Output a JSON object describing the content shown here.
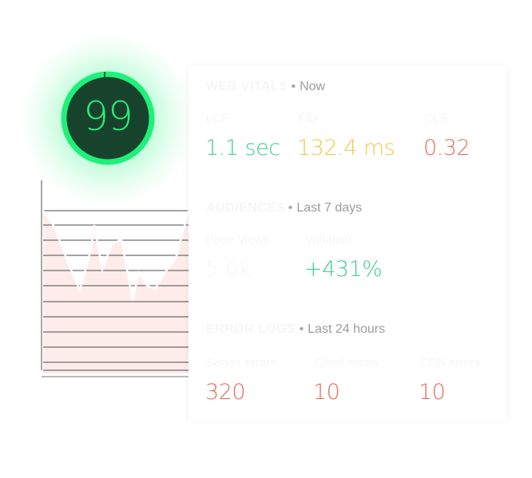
{
  "score": {
    "value": "99",
    "ring_color": "#1ef07a",
    "fill_color": "#17432c",
    "text_color": "#2bea78"
  },
  "mini_chart": {
    "series_color": "#e87a6b",
    "fill_color": "#fdecea"
  },
  "colors": {
    "good": "#3ecf8e",
    "warn": "#f2c94c",
    "bad": "#e0705f"
  },
  "sections": {
    "web_vitals": {
      "name": "WEB VITALS",
      "dot": "•",
      "period": "Now",
      "metrics": [
        {
          "label": "LCP",
          "value": "1.1 sec",
          "status": "good"
        },
        {
          "label": "FID",
          "value": "132.4 ms",
          "status": "warn"
        },
        {
          "label": "CLS",
          "value": "0.32",
          "status": "bad"
        }
      ]
    },
    "audiences": {
      "name": "AUDIENCES",
      "dot": "•",
      "period": "Last 7 days",
      "metrics": [
        {
          "label": "Page Views",
          "value": "5.6k",
          "status": "faded"
        },
        {
          "label": "Variation",
          "value": "+431%",
          "status": "good"
        }
      ]
    },
    "error_logs": {
      "name": "ERROR LOGS",
      "dot": "•",
      "period": "Last 24 hours",
      "metrics": [
        {
          "label": "Server errors",
          "value": "320",
          "status": "bad"
        },
        {
          "label": "Client errors",
          "value": "10",
          "status": "bad"
        },
        {
          "label": "CDN errors",
          "value": "10",
          "status": "bad"
        }
      ]
    }
  }
}
